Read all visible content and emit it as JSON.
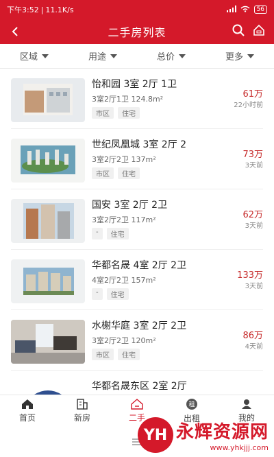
{
  "status_bar": {
    "time": "下午3:52",
    "speed": "11.1K/s",
    "battery": "56"
  },
  "header": {
    "title": "二手房列表"
  },
  "filters": [
    {
      "label": "区域"
    },
    {
      "label": "用途"
    },
    {
      "label": "总价"
    },
    {
      "label": "更多"
    }
  ],
  "listings": [
    {
      "title": "怡和园 3室 2厅 1卫",
      "spec": "3室2厅1卫 124.8m²",
      "tags": [
        "市区",
        "住宅"
      ],
      "price": "61万",
      "time": "22小时前"
    },
    {
      "title": "世纪凤凰城 3室 2厅 2",
      "spec": "3室2厅2卫 137m²",
      "tags": [
        "市区",
        "住宅"
      ],
      "price": "73万",
      "time": "3天前"
    },
    {
      "title": "国安 3室 2厅 2卫",
      "spec": "3室2厅2卫 117m²",
      "tags": [
        "-",
        "住宅"
      ],
      "price": "62万",
      "time": "3天前"
    },
    {
      "title": "华都名晟 4室 2厅 2卫",
      "spec": "4室2厅2卫 157m²",
      "tags": [
        "-",
        "住宅"
      ],
      "price": "133万",
      "time": "3天前"
    },
    {
      "title": "水榭华庭 3室 2厅 2卫",
      "spec": "3室2厅2卫 120m²",
      "tags": [
        "市区",
        "住宅"
      ],
      "price": "86万",
      "time": "4天前"
    },
    {
      "title": "华都名晟东区 2室 2厅",
      "spec": "",
      "tags": [],
      "price": "",
      "time": ""
    }
  ],
  "tabbar": [
    {
      "label": "首页",
      "icon": "home-icon"
    },
    {
      "label": "新房",
      "icon": "building-icon"
    },
    {
      "label": "二手",
      "icon": "house-icon",
      "active": true
    },
    {
      "label": "出租",
      "icon": "rent-icon"
    },
    {
      "label": "我的",
      "icon": "user-icon"
    }
  ],
  "watermark": {
    "logo": "YH",
    "name": "永辉资源网",
    "url": "www.yhkjjj.com"
  },
  "colors": {
    "brand": "#d4192a",
    "price": "#c62a2a"
  }
}
